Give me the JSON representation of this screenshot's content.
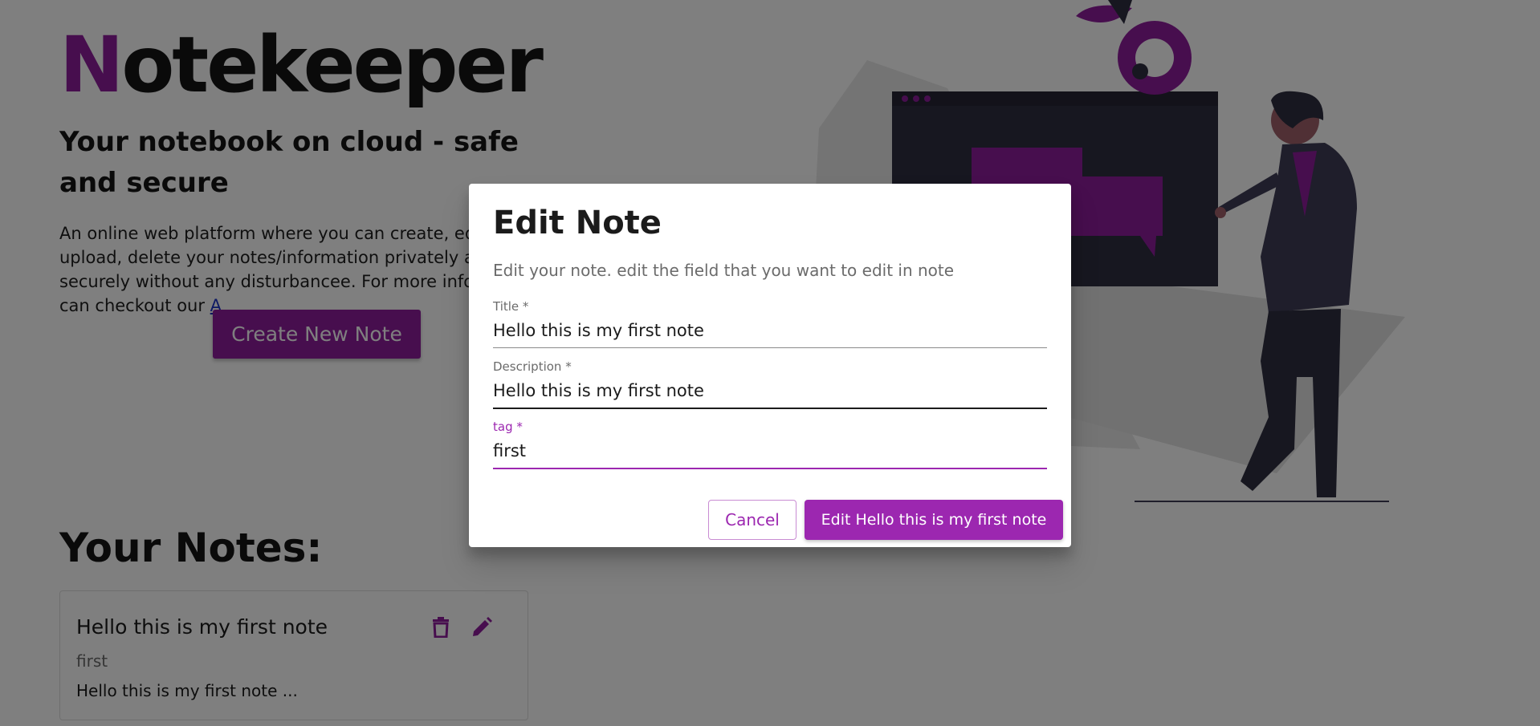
{
  "hero": {
    "brand_first_letter": "N",
    "brand_rest": "otekeeper",
    "tagline": "Your notebook on cloud - safe and secure",
    "intro_text": "An online web platform where you can create, edit, upload, delete your notes/information privately and securely without any disturbancee. For more info you can checkout our ",
    "intro_link": "A",
    "create_button": "Create New Note"
  },
  "notes": {
    "heading": "Your Notes:",
    "items": [
      {
        "title": "Hello this is my first note",
        "tag": "first",
        "description": "Hello this is my first note ...",
        "delete_icon": "trash-icon",
        "edit_icon": "pencil-icon"
      }
    ]
  },
  "dialog": {
    "title": "Edit Note",
    "text": "Edit your note. edit the field that you want to edit in note",
    "fields": {
      "title": {
        "label": "Title *",
        "value": "Hello this is my first note"
      },
      "description": {
        "label": "Description *",
        "value": "Hello this is my first note"
      },
      "tag": {
        "label": "tag *",
        "value": "first"
      }
    },
    "cancel_button": "Cancel",
    "submit_button": "Edit Hello this is my first note"
  },
  "colors": {
    "accent": "#9c27b0",
    "brand": "#8e1d9c",
    "overlay": "rgba(0,0,0,0.5)"
  }
}
